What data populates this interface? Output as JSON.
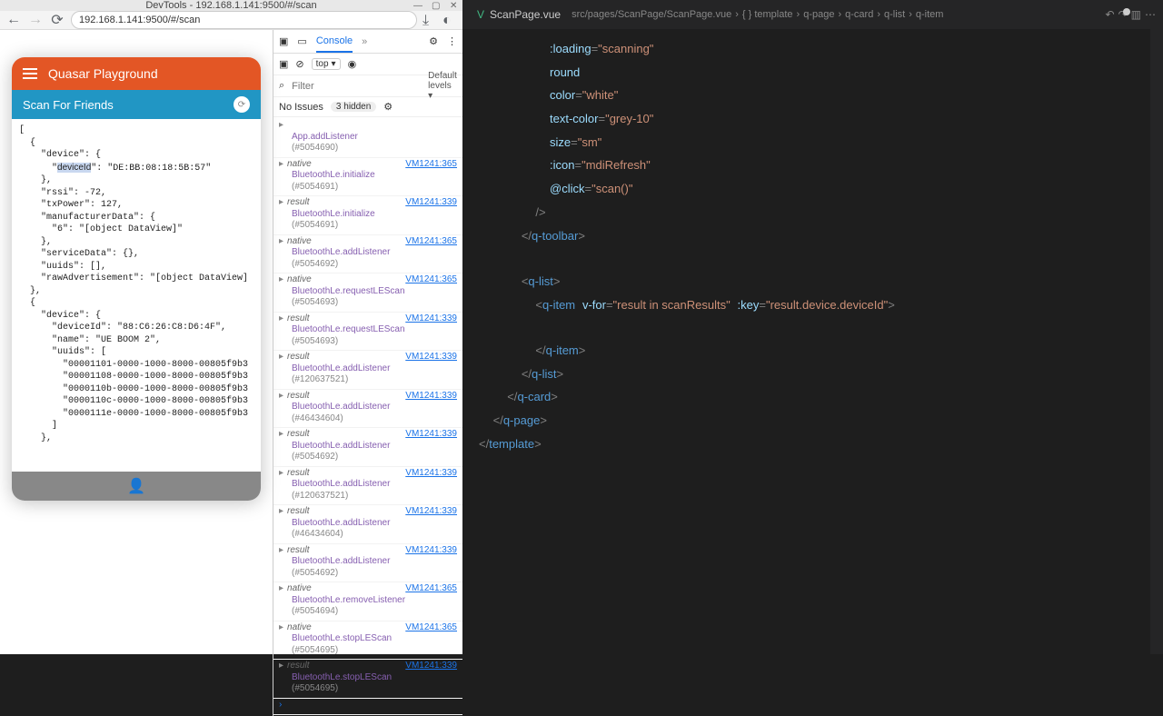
{
  "browser": {
    "title": "DevTools - 192.168.1.141:9500/#/scan",
    "url": "192.168.1.141:9500/#/scan"
  },
  "app": {
    "header": "Quasar Playground",
    "subheader": "Scan For Friends"
  },
  "json_preview": "[\n  {\n    \"device\": {\n      \"deviceId\": \"DE:BB:08:18:5B:57\"\n    },\n    \"rssi\": -72,\n    \"txPower\": 127,\n    \"manufacturerData\": {\n      \"6\": \"[object DataView]\"\n    },\n    \"serviceData\": {},\n    \"uuids\": [],\n    \"rawAdvertisement\": \"[object DataView]\n  },\n  {\n    \"device\": {\n      \"deviceId\": \"88:C6:26:C8:D6:4F\",\n      \"name\": \"UE BOOM 2\",\n      \"uuids\": [\n        \"00001101-0000-1000-8000-00805f9b3\n        \"00001108-0000-1000-8000-00805f9b3\n        \"0000110b-0000-1000-8000-00805f9b3\n        \"0000110c-0000-1000-8000-00805f9b3\n        \"0000111e-0000-1000-8000-00805f9b3\n      ]\n    },",
  "devtools": {
    "tab": "Console",
    "context": "top",
    "filter_ph": "Filter",
    "levels": "Default levels ▾",
    "issues": "No Issues",
    "hidden": "3 hidden",
    "logs": [
      {
        "k": "",
        "d": "App.addListener",
        "h": "(#5054690)",
        "s": ""
      },
      {
        "k": "native",
        "d": "BluetoothLe.initialize",
        "h": "(#5054691)",
        "s": "VM1241:365"
      },
      {
        "k": "result",
        "d": "BluetoothLe.initialize",
        "h": "(#5054691)",
        "s": "VM1241:339"
      },
      {
        "k": "native",
        "d": "BluetoothLe.addListener",
        "h": "(#5054692)",
        "s": "VM1241:365"
      },
      {
        "k": "native",
        "d": "BluetoothLe.requestLEScan",
        "h": "(#5054693)",
        "s": "VM1241:365"
      },
      {
        "k": "result",
        "d": "BluetoothLe.requestLEScan",
        "h": "(#5054693)",
        "s": "VM1241:339"
      },
      {
        "k": "result",
        "d": "BluetoothLe.addListener",
        "h": "(#120637521)",
        "s": "VM1241:339"
      },
      {
        "k": "result",
        "d": "BluetoothLe.addListener",
        "h": "(#46434604)",
        "s": "VM1241:339"
      },
      {
        "k": "result",
        "d": "BluetoothLe.addListener",
        "h": "(#5054692)",
        "s": "VM1241:339"
      },
      {
        "k": "result",
        "d": "BluetoothLe.addListener",
        "h": "(#120637521)",
        "s": "VM1241:339"
      },
      {
        "k": "result",
        "d": "BluetoothLe.addListener",
        "h": "(#46434604)",
        "s": "VM1241:339"
      },
      {
        "k": "result",
        "d": "BluetoothLe.addListener",
        "h": "(#5054692)",
        "s": "VM1241:339"
      },
      {
        "k": "native",
        "d": "BluetoothLe.removeListener",
        "h": "(#5054694)",
        "s": "VM1241:365"
      },
      {
        "k": "native",
        "d": "BluetoothLe.stopLEScan",
        "h": "(#5054695)",
        "s": "VM1241:365"
      },
      {
        "k": "result",
        "d": "BluetoothLe.stopLEScan",
        "h": "(#5054695)",
        "s": "VM1241:339"
      }
    ]
  },
  "editor": {
    "filename": "ScanPage.vue",
    "path": "src/pages/ScanPage/ScanPage.vue",
    "crumbs": [
      "{ } template",
      "q-page",
      "q-card",
      "q-list",
      "q-item"
    ]
  }
}
